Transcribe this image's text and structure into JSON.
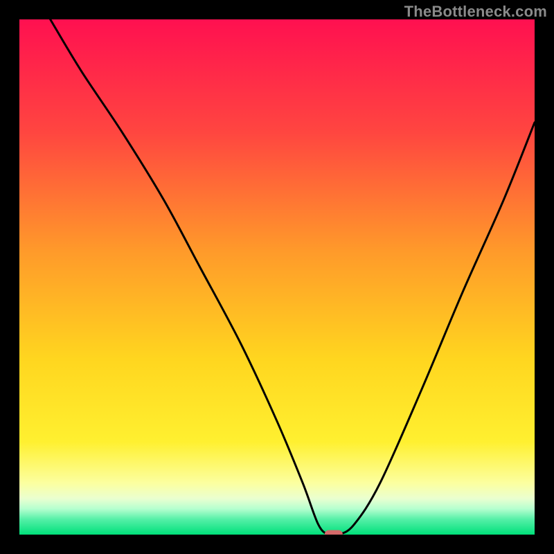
{
  "watermark": "TheBottleneck.com",
  "chart_data": {
    "type": "line",
    "title": "",
    "xlabel": "",
    "ylabel": "",
    "xlim": [
      0,
      100
    ],
    "ylim": [
      0,
      100
    ],
    "grid": false,
    "series": [
      {
        "name": "bottleneck-curve",
        "x": [
          6,
          12,
          20,
          28,
          35,
          43,
          50,
          55,
          58,
          60,
          62,
          65,
          70,
          78,
          86,
          94,
          100
        ],
        "y": [
          100,
          90,
          78,
          65,
          52,
          37,
          22,
          10,
          2,
          0,
          0,
          2,
          10,
          28,
          47,
          65,
          80
        ]
      }
    ],
    "marker": {
      "x": 61,
      "y": 0,
      "color": "#d46a6a",
      "shape": "pill"
    },
    "gradient_stops": [
      {
        "offset": 0,
        "color": "#ff1050"
      },
      {
        "offset": 22,
        "color": "#ff4640"
      },
      {
        "offset": 45,
        "color": "#ff9a2a"
      },
      {
        "offset": 66,
        "color": "#ffd61f"
      },
      {
        "offset": 82,
        "color": "#fff030"
      },
      {
        "offset": 90,
        "color": "#fcffa0"
      },
      {
        "offset": 93,
        "color": "#eaffd0"
      },
      {
        "offset": 95,
        "color": "#b5ffcf"
      },
      {
        "offset": 97,
        "color": "#56f0a8"
      },
      {
        "offset": 100,
        "color": "#00e07a"
      }
    ]
  }
}
